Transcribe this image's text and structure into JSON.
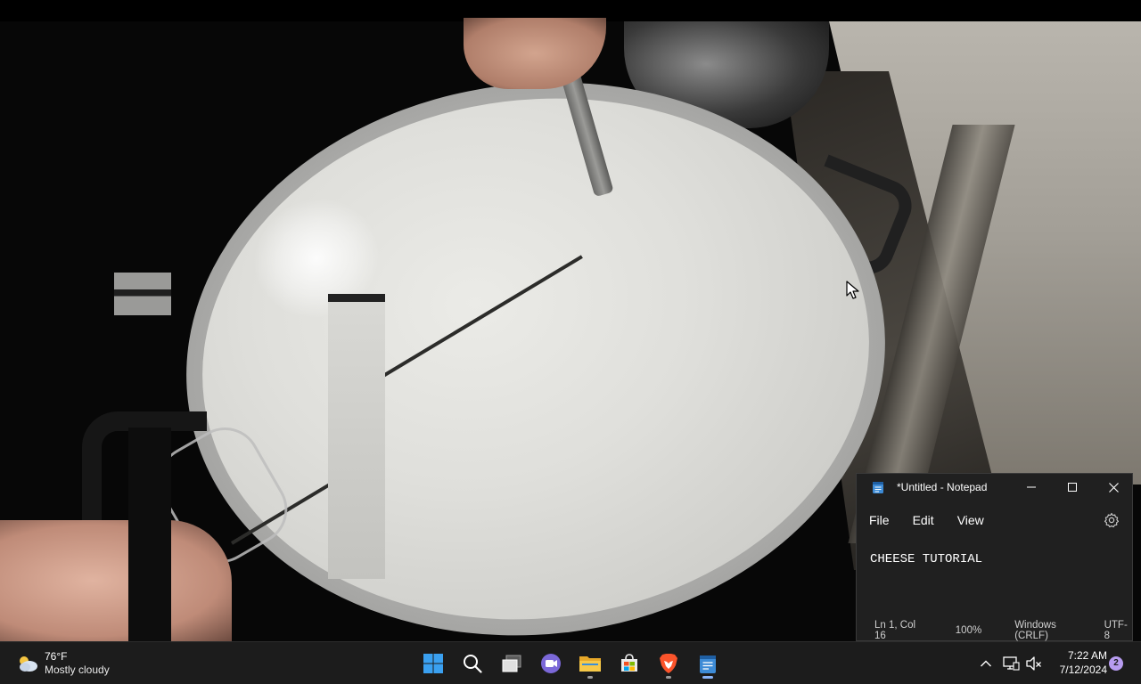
{
  "video": {
    "description_icon": "video-frame"
  },
  "notepad": {
    "title": "*Untitled - Notepad",
    "menu": [
      "File",
      "Edit",
      "View"
    ],
    "content": "CHEESE TUTORIAL",
    "status": {
      "position": "Ln 1, Col 16",
      "zoom": "100%",
      "line_ending": "Windows (CRLF)",
      "encoding": "UTF-8"
    }
  },
  "taskbar": {
    "weather": {
      "temperature": "76°F",
      "condition": "Mostly cloudy",
      "icon": "partly-cloudy-icon"
    },
    "pinned_apps": [
      {
        "name": "start",
        "icon": "windows-logo-icon"
      },
      {
        "name": "search",
        "icon": "search-icon"
      },
      {
        "name": "task-view",
        "icon": "task-view-icon"
      },
      {
        "name": "teams-chat",
        "icon": "video-chat-icon"
      },
      {
        "name": "file-explorer",
        "icon": "folder-icon"
      },
      {
        "name": "microsoft-store",
        "icon": "store-icon"
      },
      {
        "name": "brave",
        "icon": "brave-lion-icon"
      },
      {
        "name": "notepad",
        "icon": "notepad-icon"
      }
    ],
    "clock": {
      "time": "7:22 AM",
      "date": "7/12/2024"
    },
    "notifications": "2"
  },
  "colors": {
    "taskbar_bg": "#1c1c1c",
    "notepad_bg": "#202020",
    "accent": "#8ab4f8",
    "brave_orange": "#fb542b",
    "badge": "#b79cf0"
  }
}
